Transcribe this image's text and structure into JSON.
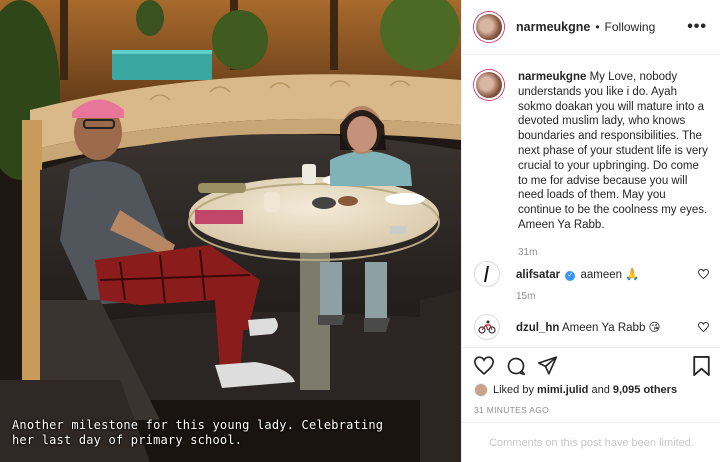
{
  "post": {
    "username": "narmeukgne",
    "follow_status": "Following",
    "more_label": "•••",
    "photo_caption_line1": "Another milestone for this young lady. Celebrating",
    "photo_caption_line2": "her last day of primary school.",
    "caption_text": "My Love, nobody understands you like i do. Ayah sokmo doakan you will mature into a devoted muslim lady, who knows boundaries and responsibilities. The next phase of your student life is very crucial to your upbringing. Do come to me for advise because you will need loads of them. May you continue to be the coolness my eyes. Ameen Ya Rabb.",
    "caption_time": "31m"
  },
  "comments": [
    {
      "username": "alifsatar",
      "verified": true,
      "text": "aameen",
      "emoji": "🙏",
      "time": "15m",
      "avatar_icon": "stroke-logo-icon"
    },
    {
      "username": "dzul_hn",
      "verified": false,
      "text": "Ameen Ya Rabb",
      "emoji": "😘",
      "time": "",
      "avatar_icon": "cyclist-icon"
    }
  ],
  "likes": {
    "prefix": "Liked by",
    "user": "mimi.julid",
    "conjunction": "and",
    "others": "9,095 others"
  },
  "posted_time": "31 MINUTES AGO",
  "comments_limited": "Comments on this post have been limited.",
  "colors": {
    "text": "#262626",
    "muted": "#8e8e8e",
    "border": "#efefef",
    "verified": "#3897f0",
    "story_ring": "#d23d6d"
  }
}
